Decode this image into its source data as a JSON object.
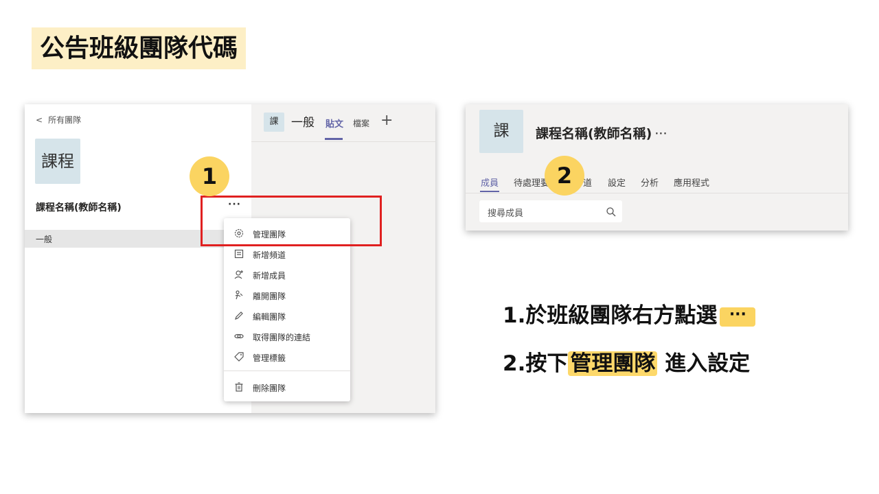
{
  "slide": {
    "title": "公告班級團隊代碼"
  },
  "left_screenshot": {
    "back_link": "所有團隊",
    "team_avatar_text": "課程",
    "team_name": "課程名稱(教師名稱)",
    "more_button": "···",
    "channel_general": "一般",
    "channel_header": {
      "avatar_text": "課",
      "channel_name": "一般",
      "tab_posts": "貼文",
      "tab_files": "檔案",
      "tab_add": "+"
    },
    "menu": {
      "items": [
        {
          "icon": "gear-icon",
          "label": "管理團隊"
        },
        {
          "icon": "add-channel-icon",
          "label": "新增頻道"
        },
        {
          "icon": "add-member-icon",
          "label": "新增成員"
        },
        {
          "icon": "leave-icon",
          "label": "離開團隊"
        },
        {
          "icon": "pencil-icon",
          "label": "編輯團隊"
        },
        {
          "icon": "link-icon",
          "label": "取得團隊的連結"
        },
        {
          "icon": "tag-icon",
          "label": "管理標籤"
        },
        {
          "icon": "trash-icon",
          "label": "刪除團隊"
        }
      ]
    },
    "step_number": "1",
    "highlight_color": "#e02020"
  },
  "right_screenshot": {
    "avatar_text": "課",
    "team_name": "課程名稱(教師名稱)",
    "more": "···",
    "tabs": [
      "成員",
      "待處理要",
      "道",
      "設定",
      "分析",
      "應用程式"
    ],
    "search_placeholder": "搜尋成員",
    "step_number": "2"
  },
  "instructions": {
    "line1_prefix": "1.",
    "line1_text": "於班級團隊右方點選",
    "line1_badge": "···",
    "line2_prefix": "2.",
    "line2_pre": "按下",
    "line2_highlight": "管理團隊",
    "line2_post": "進入設定"
  },
  "colors": {
    "accent": "#6264a7",
    "step_badge": "#fbd461",
    "title_bg": "#fdefc6"
  }
}
